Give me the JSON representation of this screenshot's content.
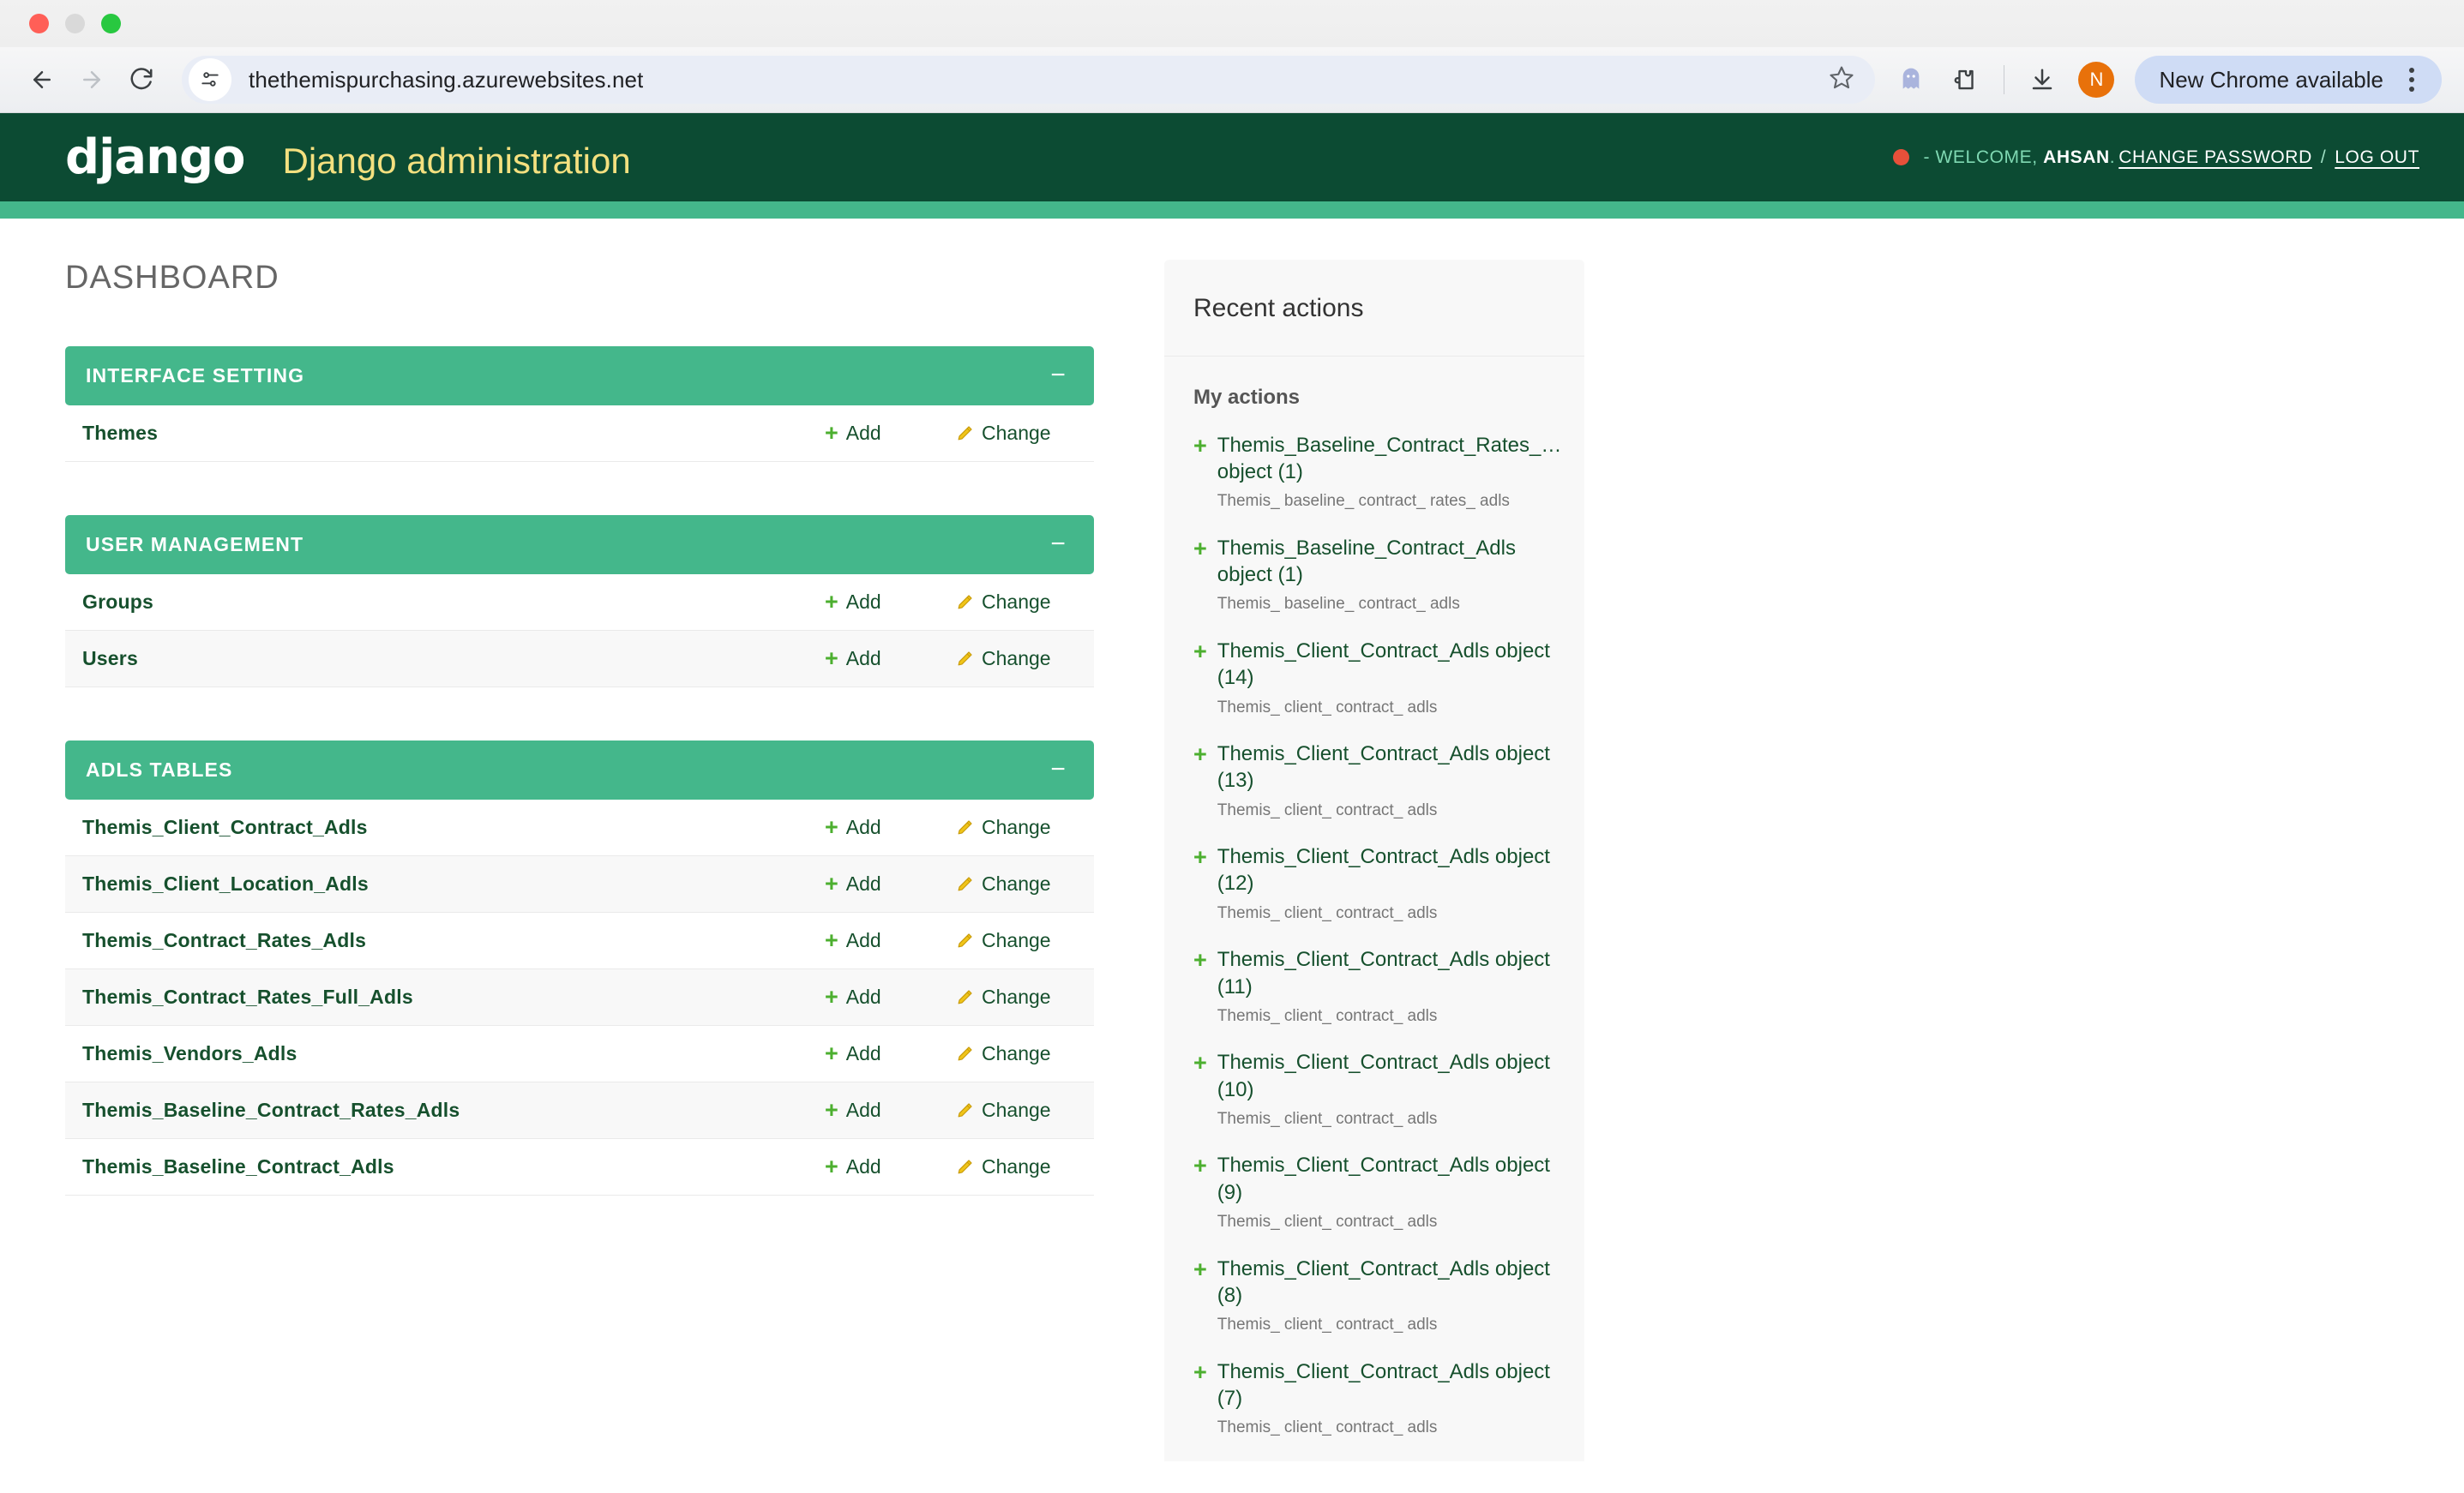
{
  "browser": {
    "url": "thethemispurchasing.azurewebsites.net",
    "back_icon": "back-arrow-icon",
    "forward_icon": "forward-arrow-icon",
    "reload_icon": "reload-icon",
    "site_settings_icon": "site-settings-icon",
    "bookmark_icon": "star-icon",
    "extension_ghost_icon": "ghost-extension-icon",
    "extensions_icon": "extensions-puzzle-icon",
    "download_icon": "download-icon",
    "profile_initial": "N",
    "update_label": "New Chrome available",
    "menu_icon": "kebab-menu-icon"
  },
  "header": {
    "logo": "django",
    "title": "Django administration",
    "user_tools": {
      "status_dot": "red-status-dot",
      "welcome_prefix": "- WELCOME,",
      "username": "AHSAN",
      "period": ".",
      "change_password": "CHANGE PASSWORD",
      "separator": "/",
      "log_out": "LOG OUT"
    }
  },
  "main": {
    "page_title": "DASHBOARD",
    "modules": [
      {
        "caption": "INTERFACE SETTING",
        "collapse": "−",
        "models": [
          {
            "name": "Themes",
            "add": "Add",
            "change": "Change"
          }
        ]
      },
      {
        "caption": "USER MANAGEMENT",
        "collapse": "−",
        "models": [
          {
            "name": "Groups",
            "add": "Add",
            "change": "Change"
          },
          {
            "name": "Users",
            "add": "Add",
            "change": "Change"
          }
        ]
      },
      {
        "caption": "ADLS TABLES",
        "collapse": "−",
        "models": [
          {
            "name": "Themis_Client_Contract_Adls",
            "add": "Add",
            "change": "Change"
          },
          {
            "name": "Themis_Client_Location_Adls",
            "add": "Add",
            "change": "Change"
          },
          {
            "name": "Themis_Contract_Rates_Adls",
            "add": "Add",
            "change": "Change"
          },
          {
            "name": "Themis_Contract_Rates_Full_Adls",
            "add": "Add",
            "change": "Change"
          },
          {
            "name": "Themis_Vendors_Adls",
            "add": "Add",
            "change": "Change"
          },
          {
            "name": "Themis_Baseline_Contract_Rates_Adls",
            "add": "Add",
            "change": "Change"
          },
          {
            "name": "Themis_Baseline_Contract_Adls",
            "add": "Add",
            "change": "Change"
          }
        ]
      }
    ]
  },
  "recent_actions": {
    "title": "Recent actions",
    "subtitle": "My actions",
    "items": [
      {
        "label": "Themis_Baseline_Contract_Rates_… object (1)",
        "model": "Themis_ baseline_ contract_ rates_ adls"
      },
      {
        "label": "Themis_Baseline_Contract_Adls object (1)",
        "model": "Themis_ baseline_ contract_ adls"
      },
      {
        "label": "Themis_Client_Contract_Adls object (14)",
        "model": "Themis_ client_ contract_ adls"
      },
      {
        "label": "Themis_Client_Contract_Adls object (13)",
        "model": "Themis_ client_ contract_ adls"
      },
      {
        "label": "Themis_Client_Contract_Adls object (12)",
        "model": "Themis_ client_ contract_ adls"
      },
      {
        "label": "Themis_Client_Contract_Adls object (11)",
        "model": "Themis_ client_ contract_ adls"
      },
      {
        "label": "Themis_Client_Contract_Adls object (10)",
        "model": "Themis_ client_ contract_ adls"
      },
      {
        "label": "Themis_Client_Contract_Adls object (9)",
        "model": "Themis_ client_ contract_ adls"
      },
      {
        "label": "Themis_Client_Contract_Adls object (8)",
        "model": "Themis_ client_ contract_ adls"
      },
      {
        "label": "Themis_Client_Contract_Adls object (7)",
        "model": "Themis_ client_ contract_ adls"
      }
    ]
  },
  "colors": {
    "header_green": "#0C4B33",
    "accent_teal": "#44B78B",
    "link_green": "#16502d",
    "plus_green": "#4caf2f",
    "pencil_yellow": "#efb80b",
    "brand_yellow": "#f4e07f",
    "status_red": "#e8503a",
    "avatar_orange": "#e8710a"
  }
}
